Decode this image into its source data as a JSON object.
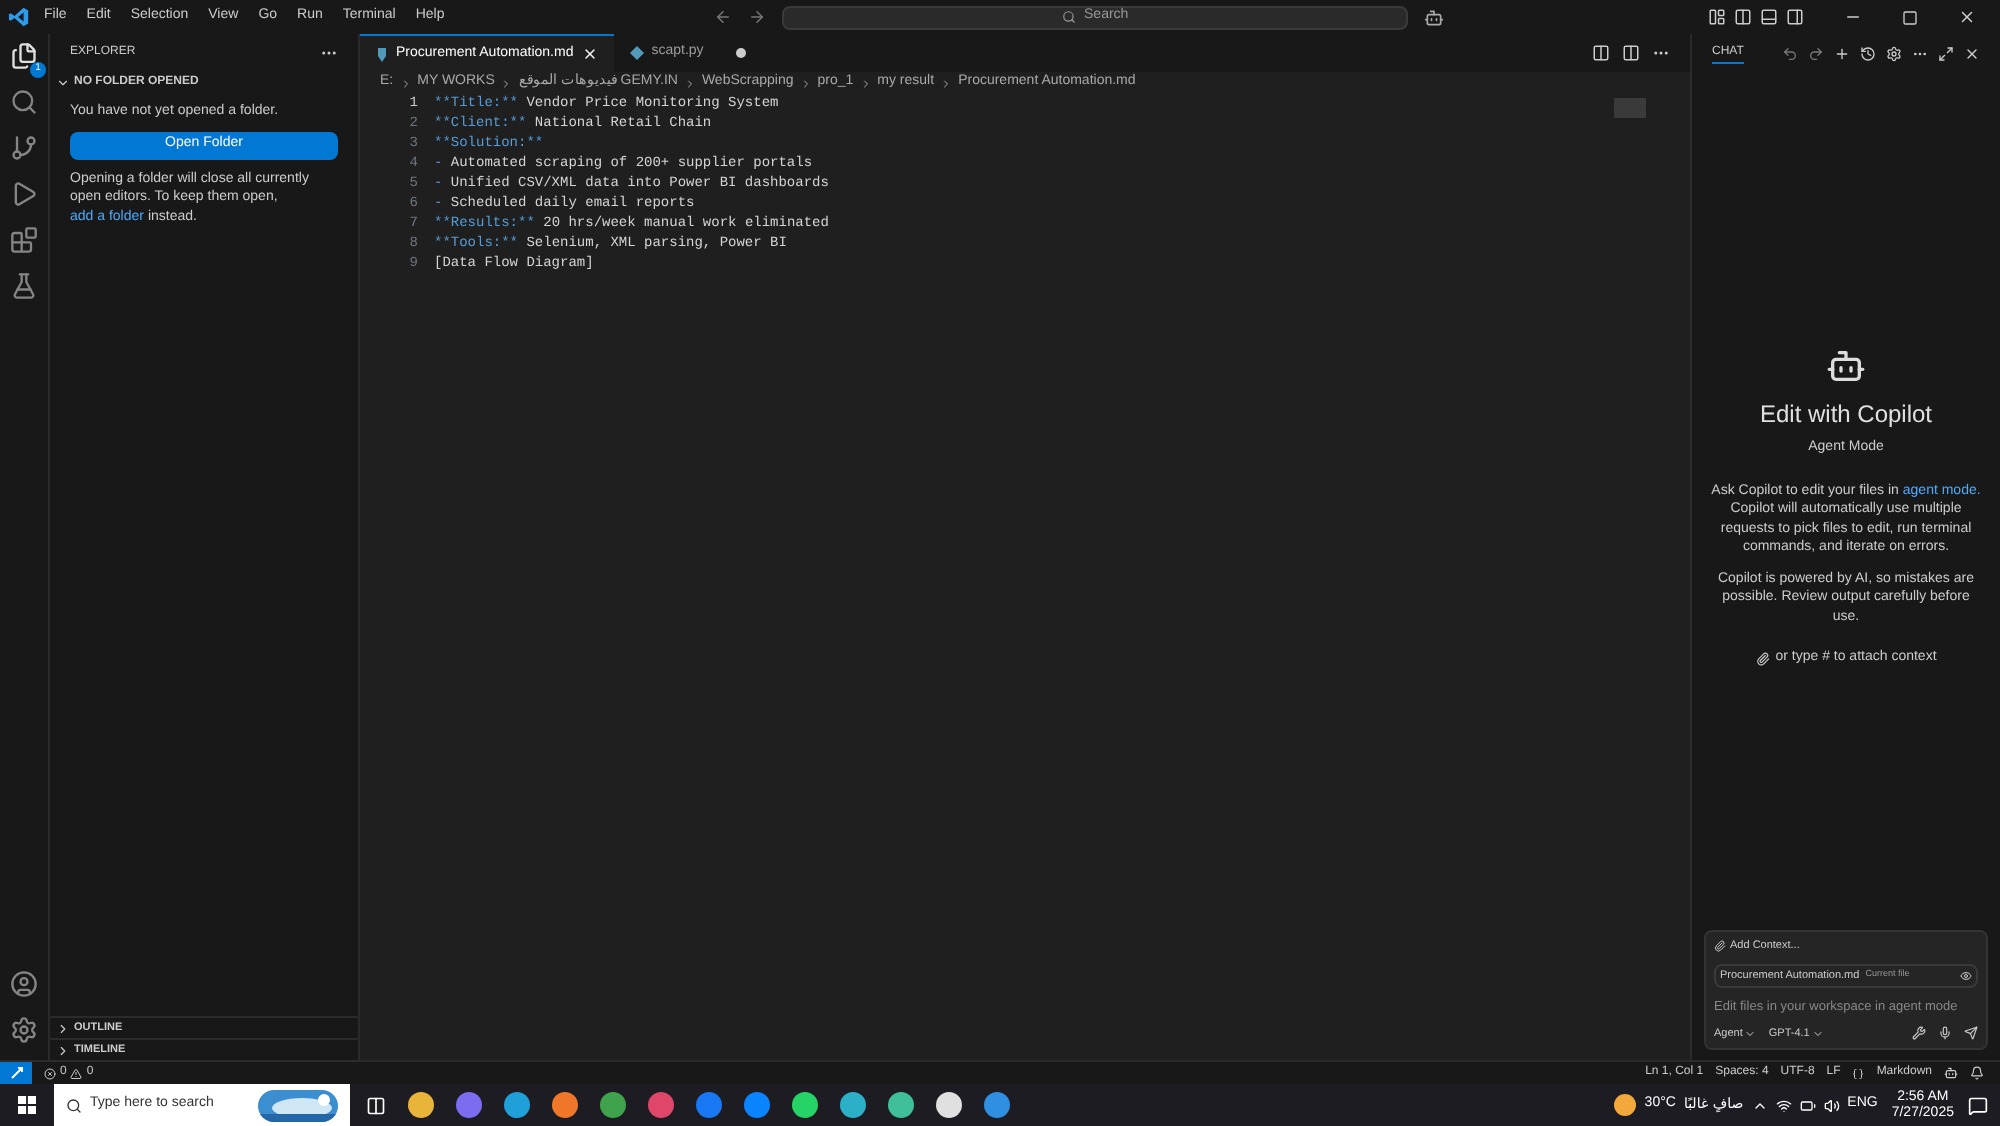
{
  "menu": [
    "File",
    "Edit",
    "Selection",
    "View",
    "Go",
    "Run",
    "Terminal",
    "Help"
  ],
  "search": {
    "placeholder": "Search"
  },
  "activity": [
    {
      "kind": "files",
      "selected": true,
      "badge": "1"
    },
    {
      "kind": "search",
      "selected": false
    },
    {
      "kind": "source",
      "selected": false
    },
    {
      "kind": "run",
      "selected": false
    },
    {
      "kind": "extensions",
      "selected": false
    },
    {
      "kind": "testing",
      "selected": false
    }
  ],
  "sidebar": {
    "title": "EXPLORER",
    "section": "NO FOLDER OPENED",
    "message": "You have not yet opened a folder.",
    "button": "Open Folder",
    "note": "Opening a folder will close all currently open editors. To keep them open,",
    "link": "add a folder",
    "note_end": "instead.",
    "bottom_sections": [
      "OUTLINE",
      "TIMELINE"
    ]
  },
  "tabs": [
    {
      "label": "Procurement Automation.md",
      "selected": true,
      "kind": "markdown",
      "dirty": false
    },
    {
      "label": "scapt.py",
      "selected": false,
      "kind": "python",
      "dirty": true
    }
  ],
  "breadcrumbs": [
    "E:",
    "MY WORKS",
    "فيديوهات الموقع GEMY.IN",
    "WebScrapping",
    "pro_1",
    "my result",
    "Procurement Automation.md"
  ],
  "lines": [
    [
      {
        "text": "**Title:**",
        "kind": "bold"
      },
      {
        "text": " Vendor Price Monitoring System",
        "kind": "plain"
      }
    ],
    [
      {
        "text": "**Client:**",
        "kind": "bold"
      },
      {
        "text": " National Retail Chain",
        "kind": "plain"
      }
    ],
    [
      {
        "text": "**Solution:**",
        "kind": "bold"
      }
    ],
    [
      {
        "text": "-",
        "kind": "bullet"
      },
      {
        "text": " Automated scraping of 200+ supplier portals",
        "kind": "plain"
      }
    ],
    [
      {
        "text": "-",
        "kind": "bullet"
      },
      {
        "text": " Unified CSV/XML data into Power BI dashboards",
        "kind": "plain"
      }
    ],
    [
      {
        "text": "-",
        "kind": "bullet"
      },
      {
        "text": " Scheduled daily email reports",
        "kind": "plain"
      }
    ],
    [
      {
        "text": "**Results:**",
        "kind": "bold"
      },
      {
        "text": " 20 hrs/week manual work eliminated",
        "kind": "plain"
      }
    ],
    [
      {
        "text": "**Tools:**",
        "kind": "bold"
      },
      {
        "text": " Selenium, XML parsing, Power BI",
        "kind": "plain"
      }
    ],
    [
      {
        "text": "[Data Flow Diagram]",
        "kind": "plain"
      }
    ]
  ],
  "line_numbers": [
    "1",
    "2",
    "3",
    "4",
    "5",
    "6",
    "7",
    "8",
    "9"
  ],
  "chat": {
    "tab": "CHAT",
    "heading": "Edit with Copilot",
    "mode": "Agent Mode",
    "intro": "Ask Copilot to edit your files in",
    "intro_link": "agent mode.",
    "intro_rest": "Copilot will automatically use multiple requests to pick files to edit, run terminal commands, and iterate on errors.",
    "disclaimer": "Copilot is powered by AI, so mistakes are possible. Review output carefully before use.",
    "hint": "or type # to attach context",
    "add_context": "Add Context...",
    "file": "Procurement Automation.md",
    "file_tag": "Current file",
    "placeholder": "Edit files in your workspace in agent mode",
    "agent": "Agent",
    "model": "GPT-4.1"
  },
  "status": {
    "errors": "0",
    "warnings": "0",
    "position": "Ln 1, Col 1",
    "spaces": "Spaces: 4",
    "encoding": "UTF-8",
    "eol": "LF",
    "language": "Markdown"
  },
  "taskbar": {
    "search_placeholder": "Type here to search",
    "apps": [
      {
        "color": "#e8b43a"
      },
      {
        "color": "#7b6cf0"
      },
      {
        "color": "#1fa0d8"
      },
      {
        "color": "#f0772a"
      },
      {
        "color": "#3fa34d"
      },
      {
        "color": "#e0456a"
      },
      {
        "color": "#1877f2"
      },
      {
        "color": "#0a84ff"
      },
      {
        "color": "#25d366"
      },
      {
        "color": "#2bb0c8"
      },
      {
        "color": "#3fbf9a"
      },
      {
        "color": "#e0e0e0"
      },
      {
        "color": "#2f8fe0"
      }
    ],
    "weather": "30°C",
    "weather_text": "صافٍ غالبًا",
    "lang": "ENG",
    "time": "2:56 AM",
    "date": "7/27/2025"
  }
}
